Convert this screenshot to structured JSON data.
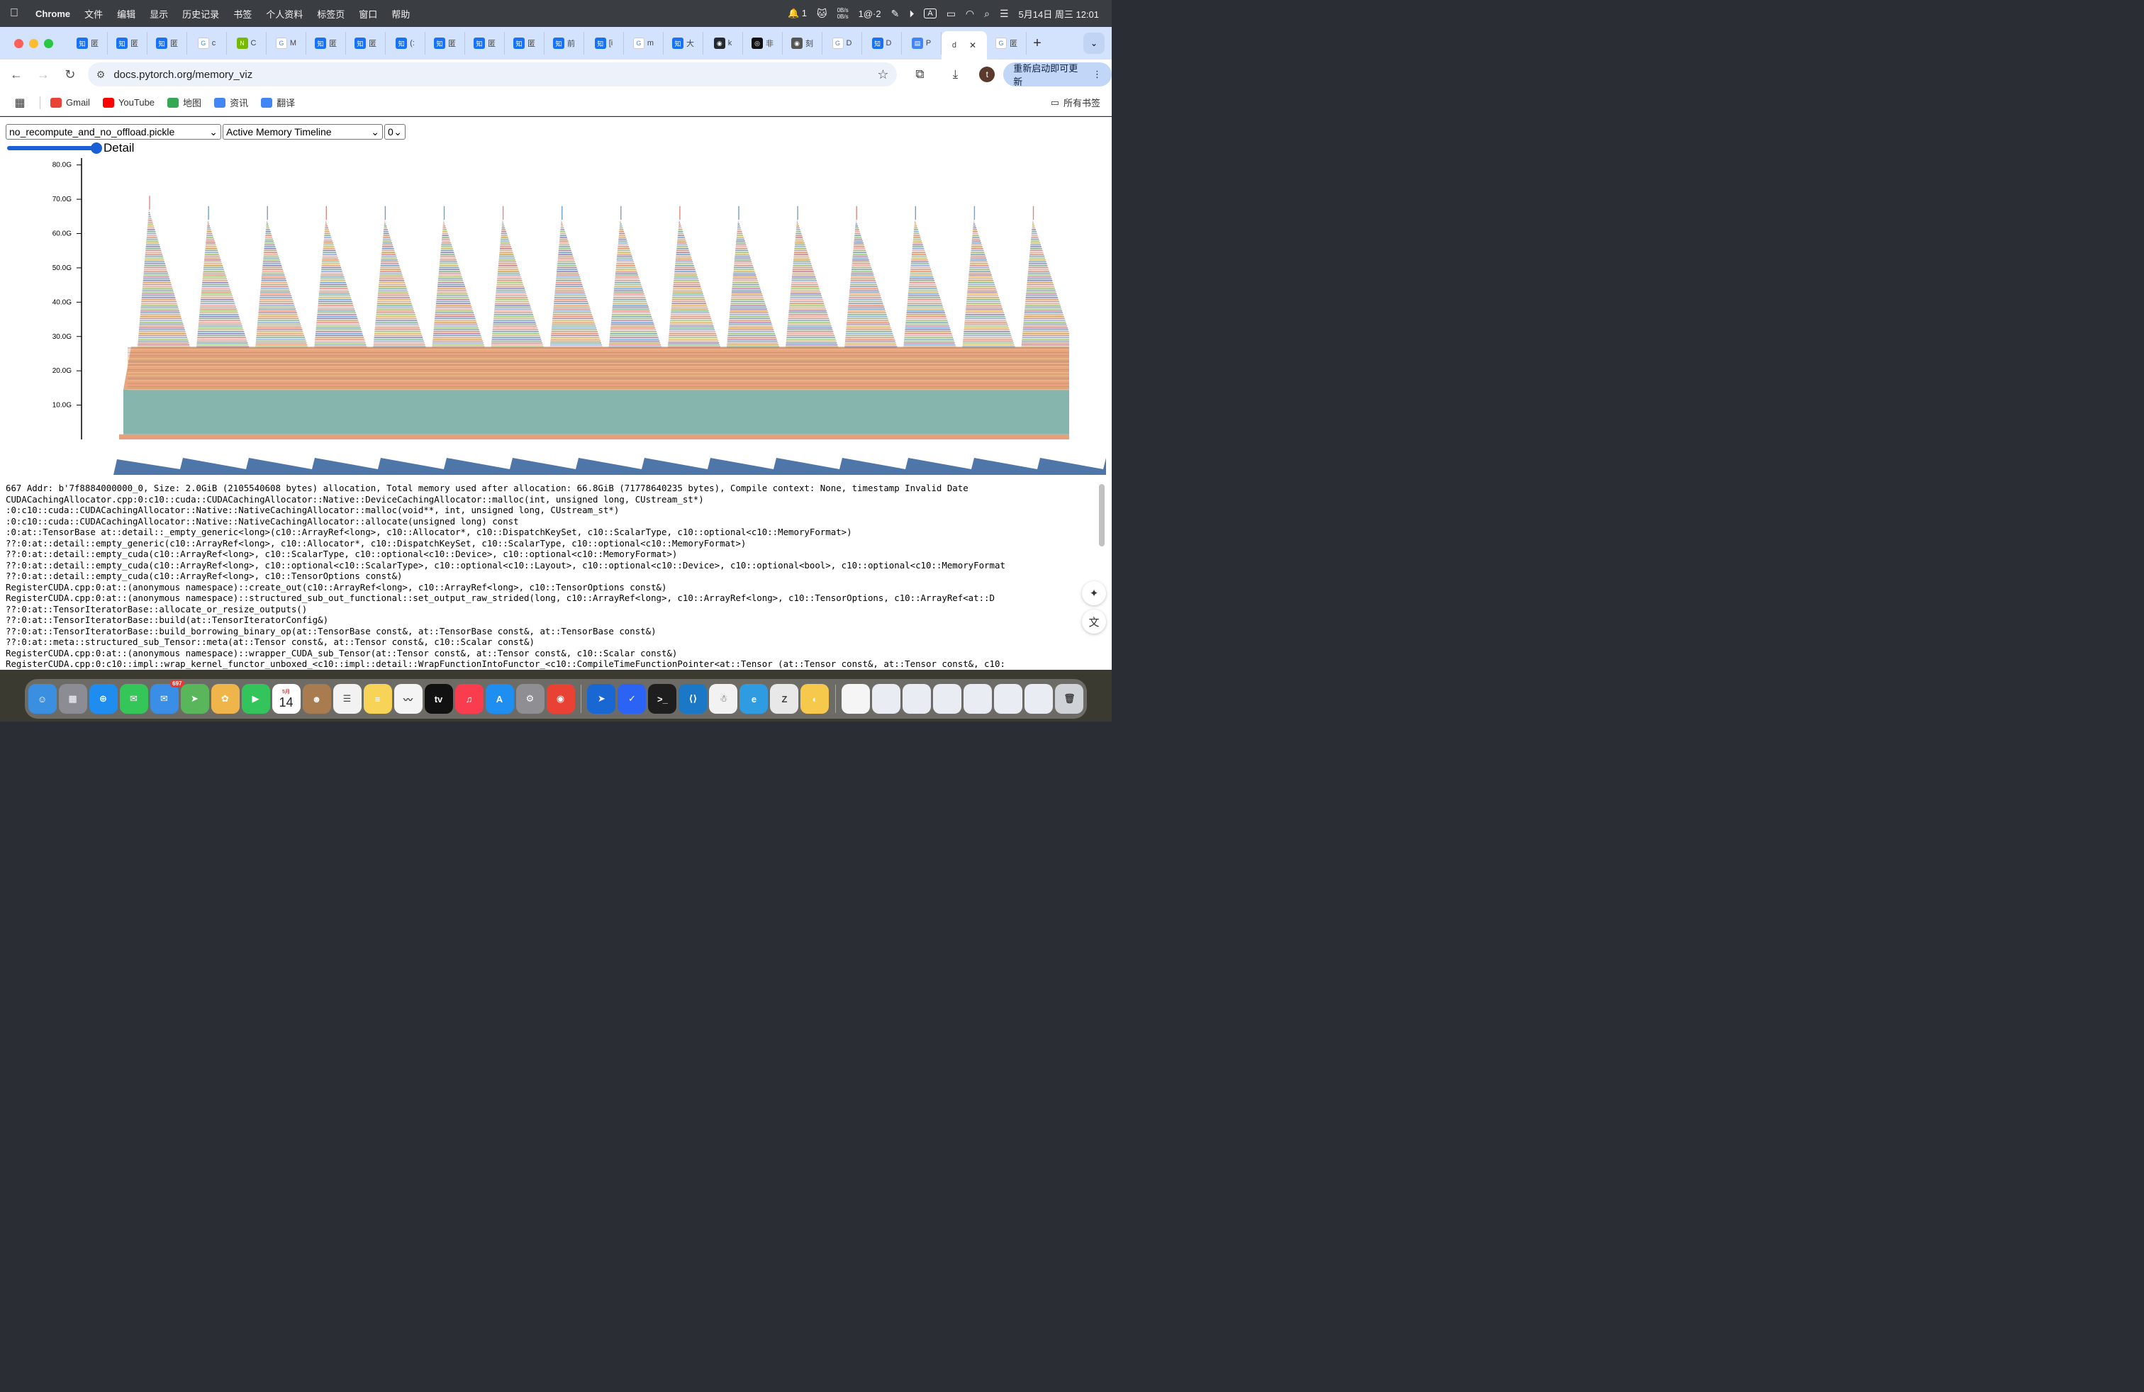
{
  "menubar": {
    "app_name": "Chrome",
    "items": [
      "文件",
      "编辑",
      "显示",
      "历史记录",
      "书签",
      "个人资料",
      "标签页",
      "窗口",
      "帮助"
    ],
    "notification_count": "1",
    "network": "0B/s",
    "input_label": "1@·2",
    "keyboard_label": "A",
    "datetime": "5月14日 周三  12:01"
  },
  "tabs": [
    {
      "fav": "知",
      "label": "匿",
      "color": "#1772f6"
    },
    {
      "fav": "知",
      "label": "匿",
      "color": "#1772f6"
    },
    {
      "fav": "知",
      "label": "匿",
      "color": "#1772f6"
    },
    {
      "fav": "G",
      "label": "c",
      "color": "#ffffff"
    },
    {
      "fav": "N",
      "label": "C",
      "color": "#76b900"
    },
    {
      "fav": "G",
      "label": "M",
      "color": "#ffffff"
    },
    {
      "fav": "知",
      "label": "匿",
      "color": "#1772f6"
    },
    {
      "fav": "知",
      "label": "匿",
      "color": "#1772f6"
    },
    {
      "fav": "知",
      "label": "(:",
      "color": "#1772f6"
    },
    {
      "fav": "知",
      "label": "匿",
      "color": "#1772f6"
    },
    {
      "fav": "知",
      "label": "匿",
      "color": "#1772f6"
    },
    {
      "fav": "知",
      "label": "匿",
      "color": "#1772f6"
    },
    {
      "fav": "知",
      "label": "前",
      "color": "#1772f6"
    },
    {
      "fav": "知",
      "label": "[i",
      "color": "#1772f6"
    },
    {
      "fav": "G",
      "label": "m",
      "color": "#ffffff"
    },
    {
      "fav": "知",
      "label": "大",
      "color": "#1772f6"
    },
    {
      "fav": "◉",
      "label": "k",
      "color": "#24292f"
    },
    {
      "fav": "◎",
      "label": "非",
      "color": "#111111"
    },
    {
      "fav": "◉",
      "label": "刻",
      "color": "#555555"
    },
    {
      "fav": "G",
      "label": "D",
      "color": "#ffffff"
    },
    {
      "fav": "知",
      "label": "D",
      "color": "#1772f6"
    },
    {
      "fav": "▤",
      "label": "P",
      "color": "#4285f4"
    }
  ],
  "active_tab": {
    "label": "d"
  },
  "last_tab": {
    "fav": "G",
    "label": "匿"
  },
  "address": {
    "url": "docs.pytorch.org/memory_viz"
  },
  "update_button": "重新启动即可更新",
  "avatar_letter": "t",
  "bookmarks": [
    {
      "label": "Gmail",
      "icon": "gmail-icon",
      "color": "#ea4335"
    },
    {
      "label": "YouTube",
      "icon": "youtube-icon",
      "color": "#ff0000"
    },
    {
      "label": "地图",
      "icon": "maps-icon",
      "color": "#34a853"
    },
    {
      "label": "资讯",
      "icon": "news-icon",
      "color": "#4285f4"
    },
    {
      "label": "翻译",
      "icon": "translate-icon",
      "color": "#4285f4"
    }
  ],
  "all_bookmarks": "所有书签",
  "viz": {
    "file_select": "no_recompute_and_no_offload.pickle",
    "view_select": "Active Memory Timeline",
    "device_select": "0",
    "detail_label": "Detail",
    "detail_level": 1.0
  },
  "chart_data": {
    "type": "area",
    "title": "",
    "xlabel": "",
    "ylabel": "",
    "yticks": [
      "10.0G",
      "20.0G",
      "30.0G",
      "40.0G",
      "50.0G",
      "60.0G",
      "70.0G",
      "80.0G"
    ],
    "ylim_gb": [
      0,
      82
    ],
    "base_layers_gb": [
      {
        "from": 0,
        "to": 1.5,
        "color": "#e8a07a"
      },
      {
        "from": 1.5,
        "to": 14.5,
        "color": "#86b5ae"
      },
      {
        "from": 14.5,
        "to": 27.0,
        "color": "#e6a67e"
      }
    ],
    "peaks": {
      "count": 16,
      "peak_gb": 67.0,
      "first_peak_gb": 70.0
    }
  },
  "trace_lines": [
    "667 Addr: b'7f8884000000_0, Size: 2.0GiB (2105540608 bytes) allocation, Total memory used after allocation: 66.8GiB (71778640235 bytes), Compile context: None, timestamp Invalid Date",
    "CUDACachingAllocator.cpp:0:c10::cuda::CUDACachingAllocator::Native::DeviceCachingAllocator::malloc(int, unsigned long, CUstream_st*)",
    ":0:c10::cuda::CUDACachingAllocator::Native::NativeCachingAllocator::malloc(void**, int, unsigned long, CUstream_st*)",
    ":0:c10::cuda::CUDACachingAllocator::Native::NativeCachingAllocator::allocate(unsigned long) const",
    ":0:at::TensorBase at::detail::_empty_generic<long>(c10::ArrayRef<long>, c10::Allocator*, c10::DispatchKeySet, c10::ScalarType, c10::optional<c10::MemoryFormat>)",
    "??:0:at::detail::empty_generic(c10::ArrayRef<long>, c10::Allocator*, c10::DispatchKeySet, c10::ScalarType, c10::optional<c10::MemoryFormat>)",
    "??:0:at::detail::empty_cuda(c10::ArrayRef<long>, c10::ScalarType, c10::optional<c10::Device>, c10::optional<c10::MemoryFormat>)",
    "??:0:at::detail::empty_cuda(c10::ArrayRef<long>, c10::optional<c10::ScalarType>, c10::optional<c10::Layout>, c10::optional<c10::Device>, c10::optional<bool>, c10::optional<c10::MemoryFormat",
    "??:0:at::detail::empty_cuda(c10::ArrayRef<long>, c10::TensorOptions const&)",
    "RegisterCUDA.cpp:0:at::(anonymous namespace)::create_out(c10::ArrayRef<long>, c10::ArrayRef<long>, c10::TensorOptions const&)",
    "RegisterCUDA.cpp:0:at::(anonymous namespace)::structured_sub_out_functional::set_output_raw_strided(long, c10::ArrayRef<long>, c10::ArrayRef<long>, c10::TensorOptions, c10::ArrayRef<at::D",
    "??:0:at::TensorIteratorBase::allocate_or_resize_outputs()",
    "??:0:at::TensorIteratorBase::build(at::TensorIteratorConfig&)",
    "??:0:at::TensorIteratorBase::build_borrowing_binary_op(at::TensorBase const&, at::TensorBase const&, at::TensorBase const&)",
    "??:0:at::meta::structured_sub_Tensor::meta(at::Tensor const&, at::Tensor const&, c10::Scalar const&)",
    "RegisterCUDA.cpp:0:at::(anonymous namespace)::wrapper_CUDA_sub_Tensor(at::Tensor const&, at::Tensor const&, c10::Scalar const&)",
    "RegisterCUDA.cpp:0:c10::impl::wrap_kernel_functor_unboxed_<c10::impl::detail::WrapFunctionIntoFunctor_<c10::CompileTimeFunctionPointer<at::Tensor (at::Tensor const&, at::Tensor const&, c10:"
  ],
  "dock": {
    "mail_badge": "697",
    "calendar_month": "5月",
    "calendar_day": "14",
    "apps": [
      {
        "name": "finder",
        "color": "#3b8fe0",
        "label": "☺"
      },
      {
        "name": "launchpad",
        "color": "#8c8c94",
        "label": "▦"
      },
      {
        "name": "safari",
        "color": "#1f8df0",
        "label": "⊕"
      },
      {
        "name": "messages",
        "color": "#35c659",
        "label": "✉"
      },
      {
        "name": "mail",
        "color": "#3a8ee6",
        "label": "✉"
      },
      {
        "name": "maps",
        "color": "#5ab65b",
        "label": "➤"
      },
      {
        "name": "photos",
        "color": "#f0b54a",
        "label": "✿"
      },
      {
        "name": "facetime",
        "color": "#33c55b",
        "label": "▶"
      },
      {
        "name": "calendar",
        "color": "#ffffff",
        "label": ""
      },
      {
        "name": "contacts",
        "color": "#a97c50",
        "label": "☻"
      },
      {
        "name": "reminders",
        "color": "#f2f2f2",
        "label": "☰"
      },
      {
        "name": "notes",
        "color": "#f7d358",
        "label": "≡"
      },
      {
        "name": "freeform",
        "color": "#f4f4f4",
        "label": "〰"
      },
      {
        "name": "tv",
        "color": "#111111",
        "label": "tv"
      },
      {
        "name": "music",
        "color": "#fa3c4f",
        "label": "♫"
      },
      {
        "name": "app-store",
        "color": "#1f8ef1",
        "label": "A"
      },
      {
        "name": "system-settings",
        "color": "#8e8e93",
        "label": "⚙"
      },
      {
        "name": "chrome",
        "color": "#e94235",
        "label": "◉"
      }
    ],
    "apps2": [
      {
        "name": "airflow",
        "color": "#1967d2",
        "label": "➤"
      },
      {
        "name": "feishu",
        "color": "#2b63f5",
        "label": "✓"
      },
      {
        "name": "terminal",
        "color": "#1e1e1e",
        "label": ">_"
      },
      {
        "name": "vscode",
        "color": "#1b78c6",
        "label": "⟨⟩"
      },
      {
        "name": "qq",
        "color": "#f2f2f2",
        "label": "☃"
      },
      {
        "name": "edge",
        "color": "#2f9be0",
        "label": "e"
      },
      {
        "name": "zotero",
        "color": "#e8e8e8",
        "label": "Z"
      },
      {
        "name": "tuna",
        "color": "#f6c84c",
        "label": "◐"
      }
    ],
    "files": [
      {
        "name": "document-file",
        "color": "#f5f5f5",
        "label": ""
      },
      {
        "name": "screenshot-1",
        "color": "#e9edf3",
        "label": ""
      },
      {
        "name": "screenshot-2",
        "color": "#e9edf3",
        "label": ""
      },
      {
        "name": "screenshot-3",
        "color": "#e9edf3",
        "label": ""
      },
      {
        "name": "screenshot-4",
        "color": "#e9edf3",
        "label": ""
      },
      {
        "name": "screenshot-5",
        "color": "#e9edf3",
        "label": ""
      },
      {
        "name": "screenshot-6",
        "color": "#e9edf3",
        "label": ""
      },
      {
        "name": "trash",
        "color": "#cfd3d8",
        "label": "🗑"
      }
    ]
  }
}
